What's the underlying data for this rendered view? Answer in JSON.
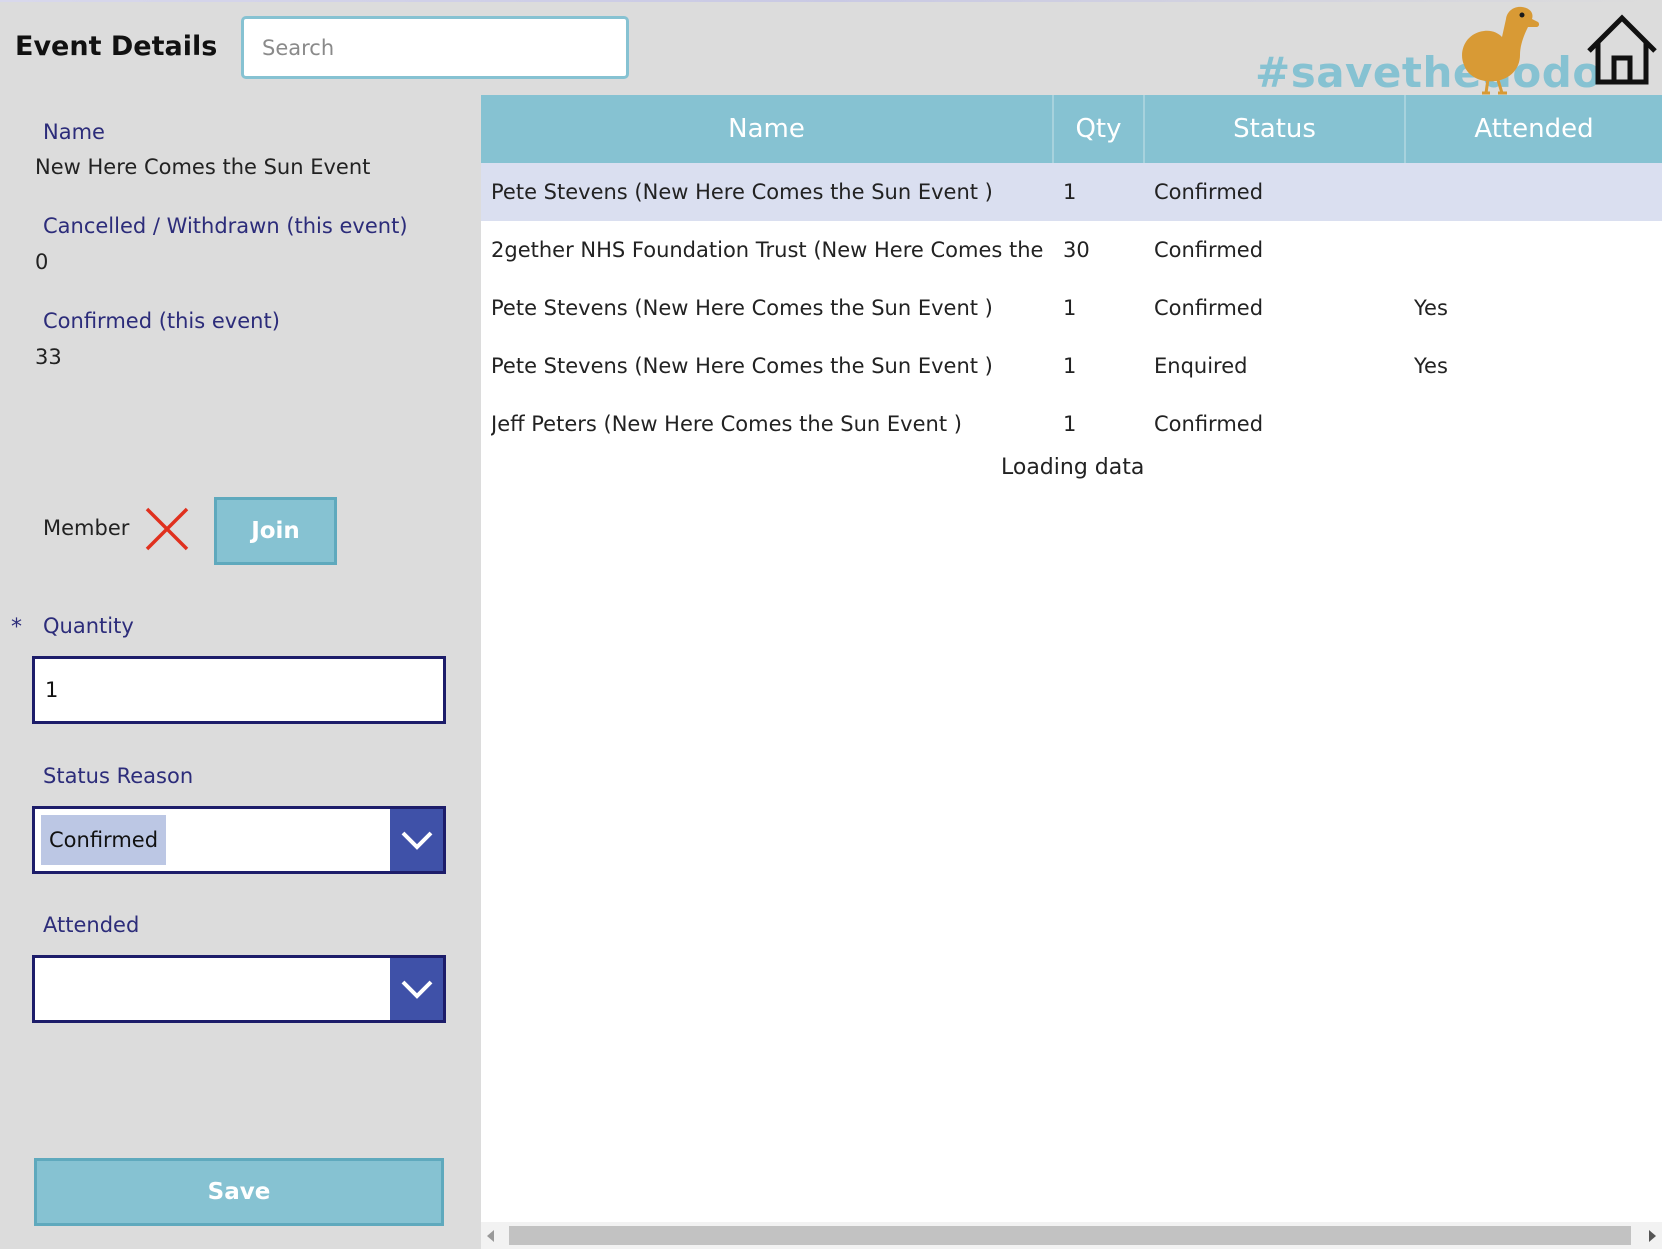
{
  "header": {
    "title": "Event Details",
    "search_placeholder": "Search",
    "brand_text": "#savethedodo",
    "logo_icon": "dodo-bird-icon",
    "home_icon": "home-icon"
  },
  "form": {
    "name_label": "Name",
    "name_value": "New Here Comes the Sun Event",
    "cancelled_label": "Cancelled / Withdrawn (this event)",
    "cancelled_value": "0",
    "confirmed_label": "Confirmed (this event)",
    "confirmed_value": "33",
    "member_label": "Member",
    "member_status_icon": "x-icon",
    "join_label": "Join",
    "required_marker": "*",
    "quantity_label": "Quantity",
    "quantity_value": "1",
    "status_reason_label": "Status Reason",
    "status_reason_value": "Confirmed",
    "attended_label": "Attended",
    "attended_value": "",
    "save_label": "Save"
  },
  "table": {
    "columns": [
      "Name",
      "Qty",
      "Status",
      "Attended"
    ],
    "rows": [
      {
        "name": "Pete Stevens (New Here Comes the Sun Event )",
        "qty": "1",
        "status": "Confirmed",
        "attended": ""
      },
      {
        "name": "2gether NHS Foundation Trust (New Here Comes the ...",
        "qty": "30",
        "status": "Confirmed",
        "attended": ""
      },
      {
        "name": "Pete Stevens (New Here Comes the Sun Event )",
        "qty": "1",
        "status": "Confirmed",
        "attended": "Yes"
      },
      {
        "name": "Pete Stevens (New Here Comes the Sun Event )",
        "qty": "1",
        "status": "Enquired",
        "attended": "Yes"
      },
      {
        "name": "Jeff Peters (New Here Comes the Sun Event )",
        "qty": "1",
        "status": "Confirmed",
        "attended": ""
      }
    ],
    "selected_row": 0,
    "loading_text": "Loading data"
  },
  "colors": {
    "accent": "#86c2d2",
    "label": "#2c2c7a",
    "dropdown_button": "#3f51a8",
    "selected_row": "#dadff0",
    "logo": "#d89a35",
    "x_mark": "#e0301e"
  }
}
